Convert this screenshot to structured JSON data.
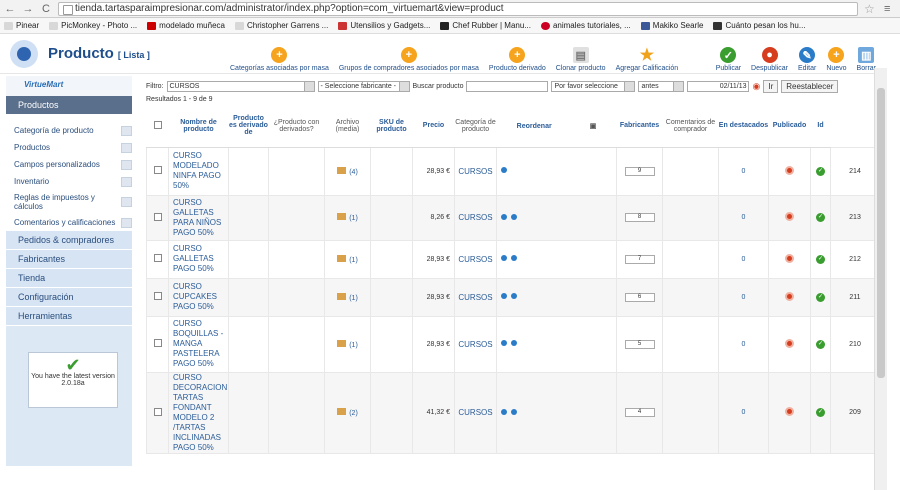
{
  "browser": {
    "url": "tienda.tartasparaimpresionar.com/administrator/index.php?option=com_virtuemart&view=product",
    "bookmarks": [
      "Pinear",
      "PicMonkey - Photo ...",
      "modelado muñeca",
      "Christopher Garrens ...",
      "Utensilios y Gadgets...",
      "Chef Rubber | Manu...",
      "animales tutoriales, ...",
      "Makiko Searle",
      "Cuánto pesan los hu..."
    ]
  },
  "header": {
    "title": "Producto",
    "subtitle": "[ Lista ]",
    "tools": [
      {
        "label": "Categorías asociadas por masa",
        "icon": "plus-icon"
      },
      {
        "label": "Grupos de compradores asociados por masa",
        "icon": "plus-icon"
      },
      {
        "label": "Producto derivado",
        "icon": "plus-icon"
      },
      {
        "label": "Clonar producto",
        "icon": "clone-icon"
      },
      {
        "label": "Agregar Calificación",
        "icon": "star-icon"
      }
    ],
    "actions": [
      {
        "label": "Publicar",
        "icon": "publish-icon"
      },
      {
        "label": "Despublicar",
        "icon": "unpublish-icon"
      },
      {
        "label": "Editar",
        "icon": "edit-icon"
      },
      {
        "label": "Nuevo",
        "icon": "new-icon"
      },
      {
        "label": "Borrar",
        "icon": "delete-icon"
      }
    ]
  },
  "sidebar": {
    "brand": "VirtueMart",
    "section_active": "Productos",
    "items": [
      "Categoría de producto",
      "Productos",
      "Campos personalizados",
      "Inventario",
      "Reglas de impuestos y cálculos",
      "Comentarios y calificaciones"
    ],
    "sections": [
      "Pedidos & compradores",
      "Fabricantes",
      "Tienda",
      "Configuración",
      "Herramientas"
    ],
    "version_notice": "You have the latest version",
    "version": "2.0.18a"
  },
  "filter": {
    "label": "Filtro:",
    "category": "CURSOS",
    "manufacturer": "- Seleccione fabricante -",
    "search_label": "Buscar producto",
    "search_value": "",
    "option": "Por favor seleccione",
    "date_op": "antes",
    "date": "02/11/13",
    "go": "Ir",
    "reset": "Reestablecer",
    "results": "Resultados 1 - 9 de 9"
  },
  "columns": [
    "Nombre de producto",
    "Producto es derivado de",
    "¿Producto con derivados?",
    "Archivo (media)",
    "SKU de producto",
    "Precio",
    "Categoría de producto",
    "Reordenar",
    "Fabricantes",
    "Comentarios de comprador",
    "En destacados",
    "Publicado",
    "Id"
  ],
  "rows": [
    {
      "name": "CURSO MODELADO NINFA PAGO 50%",
      "media": "(4)",
      "price": "28,93 €",
      "category": "CURSOS",
      "order": "9",
      "arrows": 1,
      "comments": "0",
      "id": "214"
    },
    {
      "name": "CURSO GALLETAS PARA NIÑOS PAGO 50%",
      "media": "(1)",
      "price": "8,26 €",
      "category": "CURSOS",
      "order": "8",
      "arrows": 2,
      "comments": "0",
      "id": "213"
    },
    {
      "name": "CURSO GALLETAS PAGO 50%",
      "media": "(1)",
      "price": "28,93 €",
      "category": "CURSOS",
      "order": "7",
      "arrows": 2,
      "comments": "0",
      "id": "212"
    },
    {
      "name": "CURSO CUPCAKES PAGO 50%",
      "media": "(1)",
      "price": "28,93 €",
      "category": "CURSOS",
      "order": "6",
      "arrows": 2,
      "comments": "0",
      "id": "211"
    },
    {
      "name": "CURSO BOQUILLAS - MANGA PASTELERA PAGO 50%",
      "media": "(1)",
      "price": "28,93 €",
      "category": "CURSOS",
      "order": "5",
      "arrows": 2,
      "comments": "0",
      "id": "210"
    },
    {
      "name": "CURSO DECORACION TARTAS FONDANT MODELO 2 /TARTAS INCLINADAS PAGO 50%",
      "media": "(2)",
      "price": "41,32 €",
      "category": "CURSOS",
      "order": "4",
      "arrows": 2,
      "comments": "0",
      "id": "209"
    }
  ]
}
